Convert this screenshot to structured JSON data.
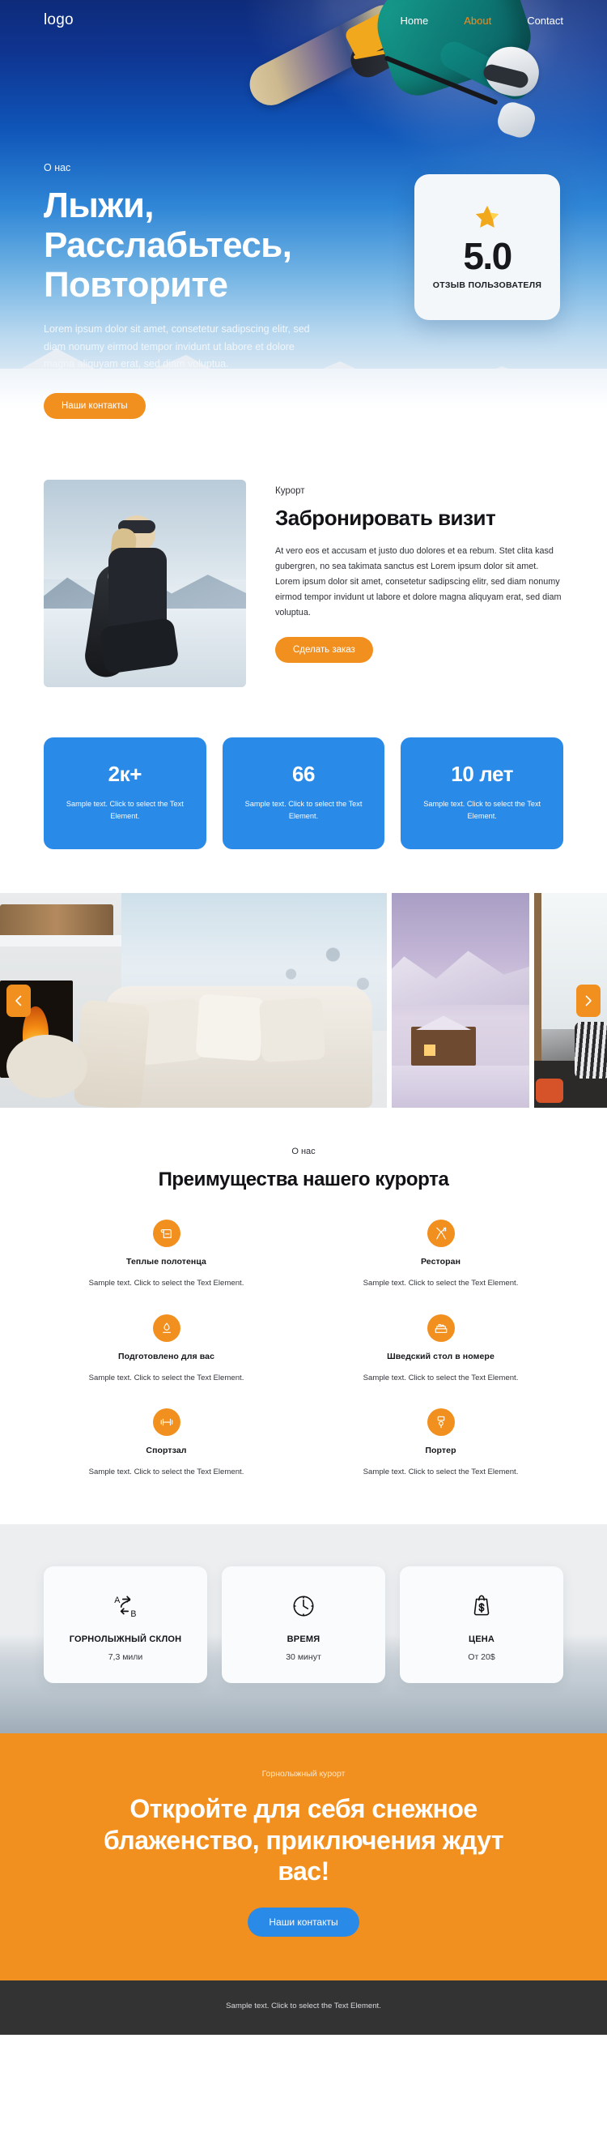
{
  "brand": {
    "logo": "logo",
    "accent_orange": "#f2901f",
    "accent_blue": "#2a8ae8"
  },
  "nav": {
    "items": [
      {
        "label": "Home",
        "active": false
      },
      {
        "label": "About",
        "active": true
      },
      {
        "label": "Contact",
        "active": false
      }
    ]
  },
  "hero": {
    "eyebrow": "О нас",
    "title": "Лыжи, Расслабьтесь, Повторите",
    "paragraph": "Lorem ipsum dolor sit amet, consetetur sadipscing elitr, sed diam nonumy eirmod tempor invidunt ut labore et dolore magna aliquyam erat, sed diam voluptua.",
    "cta_label": "Наши контакты",
    "rating": {
      "star_icon": "star-icon",
      "value": "5.0",
      "label": "ОТЗЫВ ПОЛЬЗОВАТЕЛЯ"
    }
  },
  "book": {
    "eyebrow": "Курорт",
    "title": "Забронировать визит",
    "paragraph": "At vero eos et accusam et justo duo dolores et ea rebum. Stet clita kasd gubergren, no sea takimata sanctus est Lorem ipsum dolor sit amet. Lorem ipsum dolor sit amet, consetetur sadipscing elitr, sed diam nonumy eirmod tempor invidunt ut labore et dolore magna aliquyam erat, sed diam voluptua.",
    "cta_label": "Сделать заказ",
    "photo_alt": "snowboarder-photo"
  },
  "stats": [
    {
      "number": "2к+",
      "text": "Sample text. Click to select the Text Element."
    },
    {
      "number": "66",
      "text": "Sample text. Click to select the Text Element."
    },
    {
      "number": "10 лет",
      "text": "Sample text. Click to select the Text Element."
    }
  ],
  "gallery": {
    "prev_icon": "chevron-left-icon",
    "next_icon": "chevron-right-icon",
    "items": [
      "cozy-livingroom-fireplace",
      "snowy-chalet-village",
      "cabin-window-interior"
    ]
  },
  "features": {
    "eyebrow": "О нас",
    "title": "Преимущества нашего курорта",
    "items": [
      {
        "icon": "towel-icon",
        "name": "Теплые полотенца",
        "text": "Sample text. Click to select the Text Element."
      },
      {
        "icon": "restaurant-icon",
        "name": "Ресторан",
        "text": "Sample text. Click to select the Text Element."
      },
      {
        "icon": "prepared-icon",
        "name": "Подготовлено для вас",
        "text": "Sample text. Click to select the Text Element."
      },
      {
        "icon": "room-buffet-icon",
        "name": "Шведский стол в номере",
        "text": "Sample text. Click to select the Text Element."
      },
      {
        "icon": "dumbbell-icon",
        "name": "Спортзал",
        "text": "Sample text. Click to select the Text Element."
      },
      {
        "icon": "porter-icon",
        "name": "Портер",
        "text": "Sample text. Click to select the Text Element."
      }
    ]
  },
  "info_cards": [
    {
      "icon": "route-a-to-b-icon",
      "name": "ГОРНОЛЫЖНЫЙ СКЛОН",
      "value": "7,3 мили"
    },
    {
      "icon": "clock-icon",
      "name": "ВРЕМЯ",
      "value": "30 минут"
    },
    {
      "icon": "price-tag-icon",
      "name": "ЦЕНА",
      "value": "От 20$"
    }
  ],
  "cta": {
    "eyebrow": "Горнолыжный курорт",
    "title": "Откройте для себя снежное блаженство, приключения ждут вас!",
    "button_label": "Наши контакты"
  },
  "footer": {
    "text": "Sample text. Click to select the Text Element."
  }
}
